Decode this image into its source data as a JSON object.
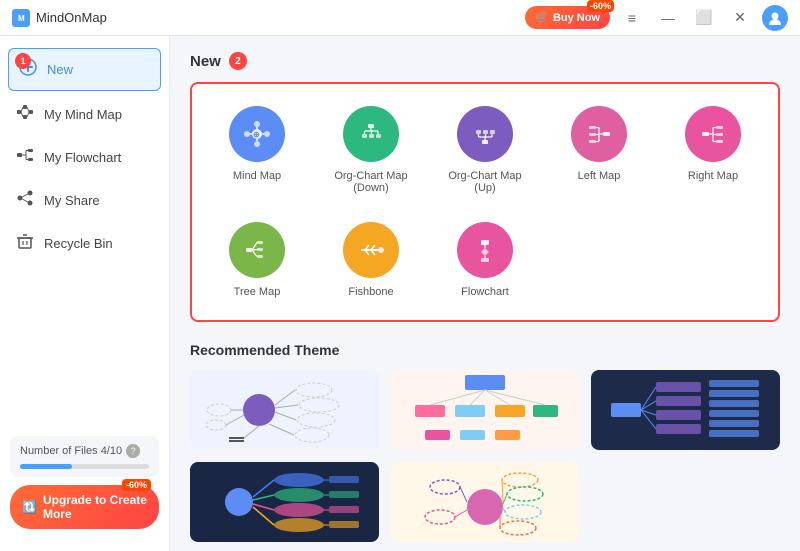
{
  "app": {
    "title": "MindOnMap"
  },
  "titlebar": {
    "buttons": [
      "≡",
      "—",
      "⬜",
      "✕"
    ],
    "buy_label": "Buy Now",
    "buy_badge": "-60%"
  },
  "sidebar": {
    "new_label": "New",
    "new_badge": "1",
    "items": [
      {
        "id": "new",
        "label": "New",
        "active": true,
        "icon": "+"
      },
      {
        "id": "my-mind-map",
        "label": "My Mind Map",
        "active": false
      },
      {
        "id": "my-flowchart",
        "label": "My Flowchart",
        "active": false
      },
      {
        "id": "my-share",
        "label": "My Share",
        "active": false
      },
      {
        "id": "recycle-bin",
        "label": "Recycle Bin",
        "active": false
      }
    ],
    "file_count_label": "Number of Files",
    "file_count_value": "4/10",
    "file_progress": 40,
    "upgrade_label": "Upgrade to Create More",
    "upgrade_badge": "-60%",
    "help_icon": "?"
  },
  "main": {
    "section_title": "New",
    "section_badge": "2",
    "templates": [
      {
        "id": "mind-map",
        "label": "Mind Map",
        "icon": "⊕",
        "color": "icon-blue"
      },
      {
        "id": "org-chart-down",
        "label": "Org-Chart Map\n(Down)",
        "icon": "⊞",
        "color": "icon-green"
      },
      {
        "id": "org-chart-up",
        "label": "Org-Chart Map (Up)",
        "icon": "⊕",
        "color": "icon-purple"
      },
      {
        "id": "left-map",
        "label": "Left Map",
        "icon": "⊟",
        "color": "icon-pink"
      },
      {
        "id": "right-map",
        "label": "Right Map",
        "icon": "⊟",
        "color": "icon-pink2"
      },
      {
        "id": "tree-map",
        "label": "Tree Map",
        "icon": "⊞",
        "color": "icon-orange-green"
      },
      {
        "id": "fishbone",
        "label": "Fishbone",
        "icon": "⊛",
        "color": "icon-orange"
      },
      {
        "id": "flowchart",
        "label": "Flowchart",
        "icon": "⊕",
        "color": "icon-red-pink"
      }
    ],
    "recommended_title": "Recommended Theme"
  }
}
